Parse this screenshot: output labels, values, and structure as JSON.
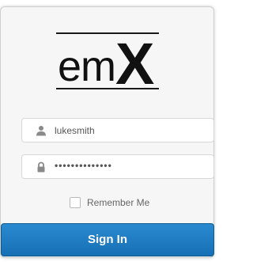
{
  "logo": {
    "text": "em",
    "accent": "X"
  },
  "login": {
    "username": {
      "value": "lukesmith",
      "icon": "user-icon"
    },
    "password": {
      "value": "••••••••••••••",
      "icon": "lock-icon"
    },
    "remember_label": "Remember Me",
    "remember_checked": false,
    "submit_label": "Sign In"
  },
  "colors": {
    "button": "#1a77bd",
    "button_border": "#0f5b8f",
    "card_bg": "#f6f6f6",
    "icon": "#8a8a8a"
  }
}
